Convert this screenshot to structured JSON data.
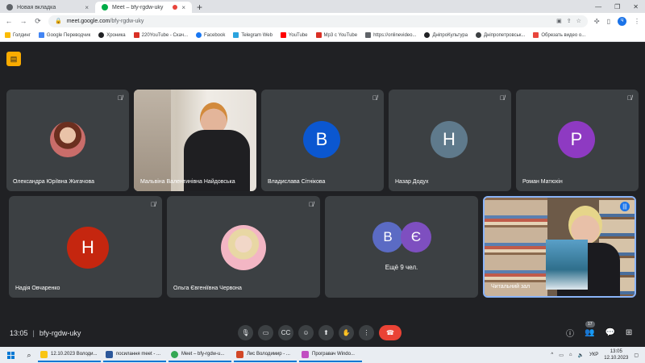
{
  "browser": {
    "tabs": [
      {
        "label": "Новая вкладка",
        "close": "×",
        "favicon_color": "#5f6368"
      },
      {
        "label": "Meet – bfy-rgdw-uky",
        "close": "×",
        "favicon_color": "#00ac47"
      }
    ],
    "new_tab": "+",
    "window_controls": [
      "—",
      "❐",
      "✕"
    ],
    "url_host": "meet.google.com",
    "url_path": "/bfy-rgdw-uky",
    "nav": {
      "back": "←",
      "forward": "→",
      "reload": "⟳"
    },
    "profile_initial": "Ч",
    "bookmarks": [
      {
        "label": "Голдинг",
        "color": "#fbbc04"
      },
      {
        "label": "Google Переводчик",
        "color": "#4285f4"
      },
      {
        "label": "Хроника",
        "color": "#202124"
      },
      {
        "label": "220YouTube - Скач...",
        "color": "#d93025"
      },
      {
        "label": "Facebook",
        "color": "#1877f2"
      },
      {
        "label": "Telegram Web",
        "color": "#2aa3de"
      },
      {
        "label": "YouTube",
        "color": "#ff0000"
      },
      {
        "label": "Mp3 с YouTube",
        "color": "#d93025"
      },
      {
        "label": "https://onlinevideo...",
        "color": "#5f6368"
      },
      {
        "label": "ДніпроКультура",
        "color": "#202124"
      },
      {
        "label": "Дніпропетровськ...",
        "color": "#3c4043"
      },
      {
        "label": "Обрезать видео о...",
        "color": "#e8453c"
      }
    ]
  },
  "meet": {
    "tiles_row1": [
      {
        "name": "Олександра Юріївна Жигачова",
        "type": "photo"
      },
      {
        "name": "Мальвіна Валентинівна Найдовська",
        "type": "video"
      },
      {
        "name": "Владислава Сітнікова",
        "type": "initial",
        "initial": "В",
        "color": "#0b57d0"
      },
      {
        "name": "Назар Додух",
        "type": "initial",
        "initial": "Н",
        "color": "#5f7a8c"
      },
      {
        "name": "Роман Матюхін",
        "type": "initial",
        "initial": "Р",
        "color": "#8e3ac2"
      }
    ],
    "tiles_row2": [
      {
        "name": "Надія Овчаренко",
        "type": "initial",
        "initial": "Н",
        "color": "#c5260f"
      },
      {
        "name": "Ольга Євгеніївна Червона",
        "type": "photo"
      },
      {
        "more_label": "Ещё 9 чел.",
        "initials": [
          "В",
          "Є"
        ],
        "colors": [
          "#5b6bc4",
          "#7e4fc0"
        ]
      },
      {
        "name": "Читальний зал",
        "type": "video"
      }
    ],
    "mute_icon": "🎙̸",
    "controls": {
      "time": "13:05",
      "separator": "|",
      "meeting_code": "bfy-rgdw-uky",
      "people_count": "17"
    }
  },
  "taskbar": {
    "items": [
      {
        "label": "12.10.2023 Володи...",
        "color": "#f9c513"
      },
      {
        "label": "посилання meet - ...",
        "color": "#2b579a"
      },
      {
        "label": "Meet – bfy-rgdw-u...",
        "color": "#34a853"
      },
      {
        "label": "Лис Володимир - ...",
        "color": "#d24726"
      },
      {
        "label": "Програвач Windo...",
        "color": "#c14fc1"
      }
    ],
    "lang": "УКР",
    "clock_time": "13:05",
    "clock_date": "12.10.2023"
  }
}
